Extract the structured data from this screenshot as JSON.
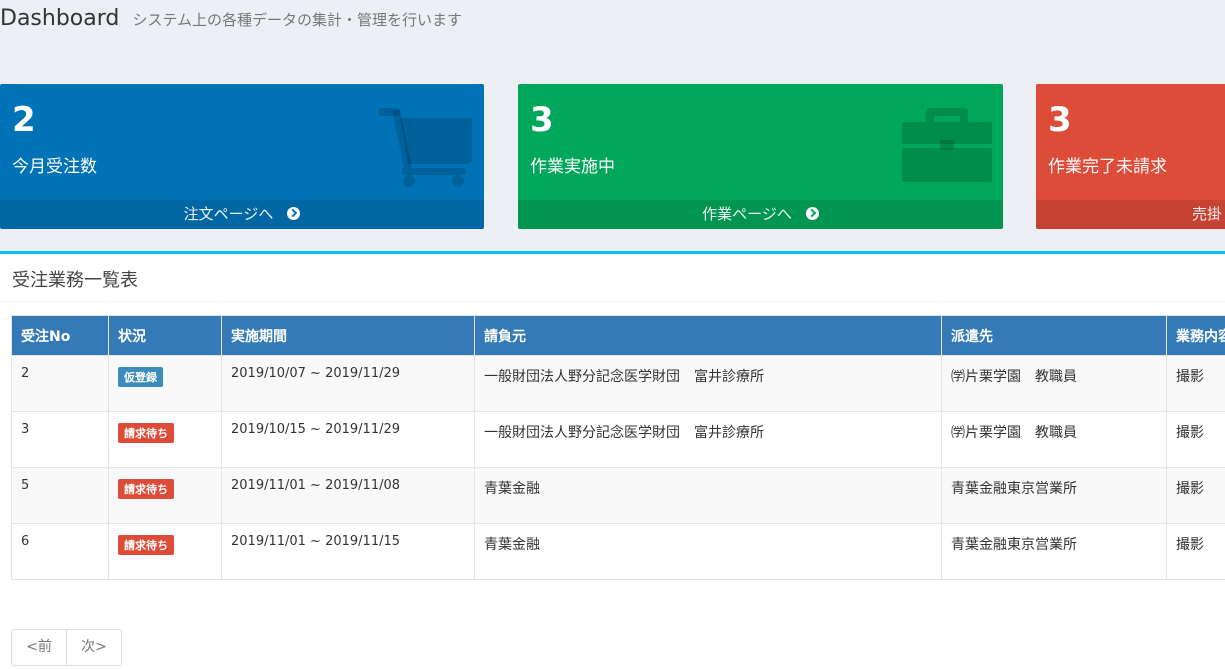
{
  "header": {
    "title": "Dashboard",
    "subtitle": "システム上の各種データの集計・管理を行います"
  },
  "boxes": [
    {
      "count": "2",
      "label": "今月受注数",
      "link": "注文ページへ",
      "icon": "shopping-cart-icon",
      "color": "#0073b7"
    },
    {
      "count": "3",
      "label": "作業実施中",
      "link": "作業ページへ",
      "icon": "briefcase-icon",
      "color": "#00a65a"
    },
    {
      "count": "3",
      "label": "作業完了未請求",
      "link": "売掛",
      "icon": "",
      "color": "#dd4b39"
    }
  ],
  "panel": {
    "title": "受注業務一覧表",
    "accent": "#00c0ef"
  },
  "table": {
    "columns": [
      "受注No",
      "状況",
      "実施期間",
      "請負元",
      "派遣先",
      "業務内容"
    ],
    "rows": [
      {
        "no": "2",
        "status": "仮登録",
        "status_color": "#3c8dbc",
        "period": "2019/10/07 ~ 2019/11/29",
        "client": "一般財団法人野分記念医学財団　富井診療所",
        "dest": "㈻片栗学園　教職員",
        "work": "撮影"
      },
      {
        "no": "3",
        "status": "請求待ち",
        "status_color": "#dd4b39",
        "period": "2019/10/15 ~ 2019/11/29",
        "client": "一般財団法人野分記念医学財団　富井診療所",
        "dest": "㈻片栗学園　教職員",
        "work": "撮影"
      },
      {
        "no": "5",
        "status": "請求待ち",
        "status_color": "#dd4b39",
        "period": "2019/11/01 ~ 2019/11/08",
        "client": "青葉金融",
        "dest": "青葉金融東京営業所",
        "work": "撮影"
      },
      {
        "no": "6",
        "status": "請求待ち",
        "status_color": "#dd4b39",
        "period": "2019/11/01 ~ 2019/11/15",
        "client": "青葉金融",
        "dest": "青葉金融東京営業所",
        "work": "撮影"
      }
    ]
  },
  "pager": {
    "prev": "<前",
    "next": "次>"
  }
}
